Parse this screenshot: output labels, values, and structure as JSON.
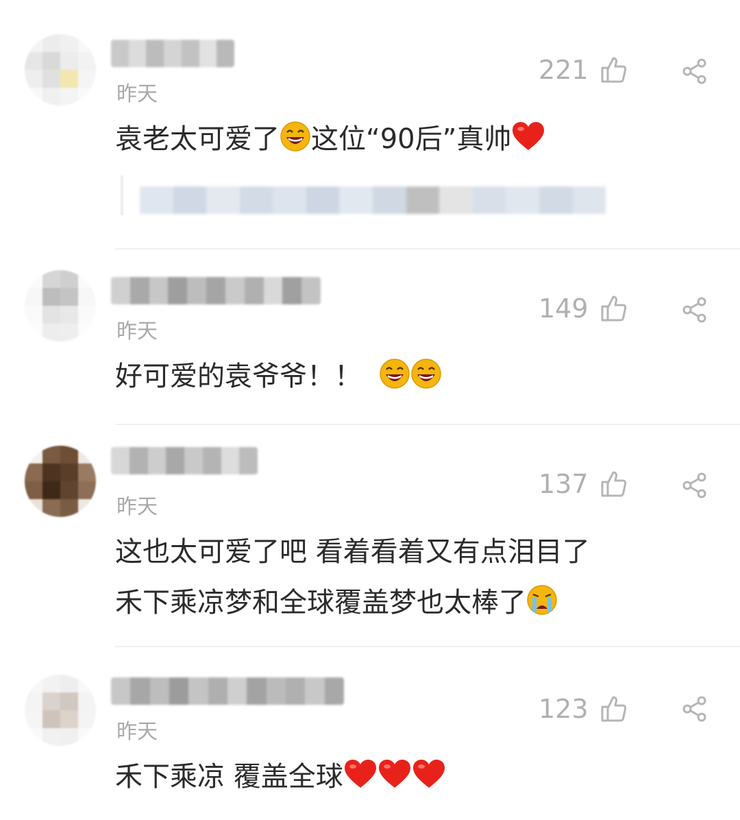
{
  "comments": [
    {
      "time": "昨天",
      "likes": "221",
      "text": "袁老太可爱了",
      "text_emoji1": "laugh-emoji",
      "text2": "这位“90后”真帅",
      "text_emoji2": "heart-emoji"
    },
    {
      "time": "昨天",
      "likes": "149",
      "text": "好可爱的袁爷爷！！",
      "text_emoji": "laugh-emoji"
    },
    {
      "time": "昨天",
      "likes": "137",
      "text_line1": "这也太可爱了吧 看着看着又有点泪目了",
      "text_line2": "禾下乘凉梦和全球覆盖梦也太棒了",
      "text_emoji": "crying-emoji"
    },
    {
      "time": "昨天",
      "likes": "123",
      "text": "禾下乘凉 覆盖全球",
      "text_emoji": "heart-emoji"
    }
  ],
  "colors": {
    "text": "#2b2b2b",
    "meta": "#a9a9a9",
    "heart": "#e8221b",
    "emoji_face": "#f5b50f"
  }
}
